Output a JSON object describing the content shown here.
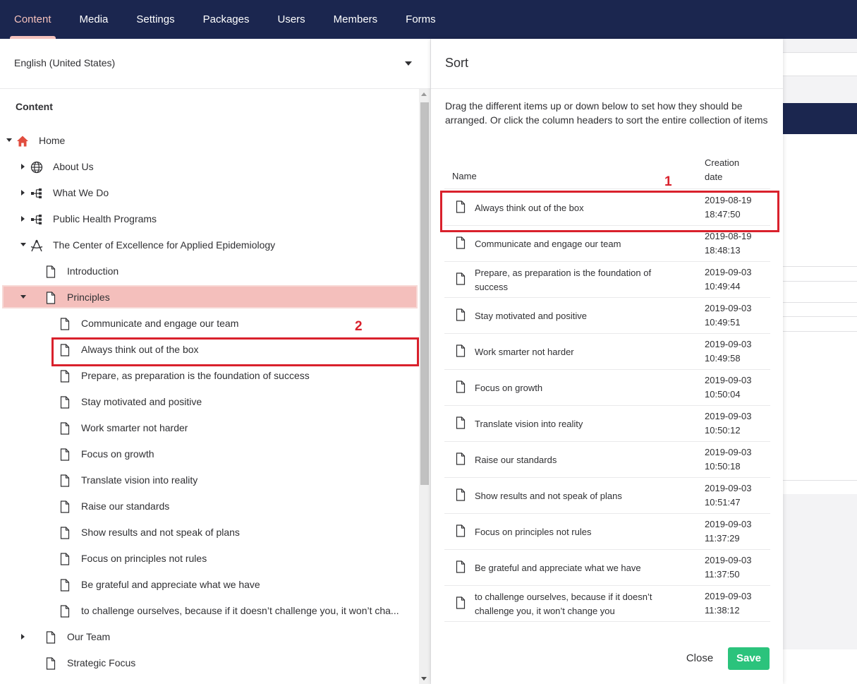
{
  "nav": {
    "items": [
      "Content",
      "Media",
      "Settings",
      "Packages",
      "Users",
      "Members",
      "Forms"
    ],
    "active": "Content"
  },
  "tree": {
    "language": "English (United States)",
    "section_title": "Content",
    "nodes": [
      {
        "label": "Home",
        "icon": "home-icon",
        "arrow": "down",
        "depth": 0
      },
      {
        "label": "About Us",
        "icon": "globe-icon",
        "arrow": "right",
        "depth": 1
      },
      {
        "label": "What We Do",
        "icon": "sitemap-icon",
        "arrow": "right",
        "depth": 1
      },
      {
        "label": "Public Health Programs",
        "icon": "sitemap-icon",
        "arrow": "right",
        "depth": 1
      },
      {
        "label": "The Center of Excellence for Applied Epidemiology",
        "icon": "compass-icon",
        "arrow": "down",
        "depth": 1
      },
      {
        "label": "Introduction",
        "icon": "document-icon",
        "arrow": "",
        "depth": 2
      },
      {
        "label": "Principles",
        "icon": "document-icon",
        "arrow": "down",
        "depth": 2,
        "selected": true
      },
      {
        "label": "Communicate and engage our team",
        "icon": "document-icon",
        "arrow": "",
        "depth": 3
      },
      {
        "label": "Always think out of the box",
        "icon": "document-icon",
        "arrow": "",
        "depth": 3
      },
      {
        "label": "Prepare, as preparation is the foundation of success",
        "icon": "document-icon",
        "arrow": "",
        "depth": 3
      },
      {
        "label": "Stay motivated and positive",
        "icon": "document-icon",
        "arrow": "",
        "depth": 3
      },
      {
        "label": "Work smarter not harder",
        "icon": "document-icon",
        "arrow": "",
        "depth": 3
      },
      {
        "label": "Focus on growth",
        "icon": "document-icon",
        "arrow": "",
        "depth": 3
      },
      {
        "label": "Translate vision into reality",
        "icon": "document-icon",
        "arrow": "",
        "depth": 3
      },
      {
        "label": "Raise our standards",
        "icon": "document-icon",
        "arrow": "",
        "depth": 3
      },
      {
        "label": "Show results and not speak of plans",
        "icon": "document-icon",
        "arrow": "",
        "depth": 3
      },
      {
        "label": "Focus on principles not rules",
        "icon": "document-icon",
        "arrow": "",
        "depth": 3
      },
      {
        "label": "Be grateful and appreciate what we have",
        "icon": "document-icon",
        "arrow": "",
        "depth": 3
      },
      {
        "label": "to challenge ourselves, because if it doesn’t challenge you, it won’t cha...",
        "icon": "document-icon",
        "arrow": "",
        "depth": 3
      },
      {
        "label": "Our Team",
        "icon": "document-icon",
        "arrow": "right",
        "depth": 2
      },
      {
        "label": "Strategic Focus",
        "icon": "document-icon",
        "arrow": "",
        "depth": 2
      }
    ]
  },
  "annotations": {
    "marker_1": "1",
    "marker_2": "2"
  },
  "sort_dialog": {
    "title": "Sort",
    "description": "Drag the different items up or down below to set how they should be arranged. Or click the column headers to sort the entire collection of items",
    "col_name": "Name",
    "col_date": "Creation date",
    "rows": [
      {
        "name": "Always think out of the box",
        "date": "2019-08-19 18:47:50"
      },
      {
        "name": "Communicate and engage our team",
        "date": "2019-08-19 18:48:13"
      },
      {
        "name": "Prepare, as preparation is the foundation of success",
        "date": "2019-09-03 10:49:44"
      },
      {
        "name": "Stay motivated and positive",
        "date": "2019-09-03 10:49:51"
      },
      {
        "name": "Work smarter not harder",
        "date": "2019-09-03 10:49:58"
      },
      {
        "name": "Focus on growth",
        "date": "2019-09-03 10:50:04"
      },
      {
        "name": "Translate vision into reality",
        "date": "2019-09-03 10:50:12"
      },
      {
        "name": "Raise our standards",
        "date": "2019-09-03 10:50:18"
      },
      {
        "name": "Show results and not speak of plans",
        "date": "2019-09-03 10:51:47"
      },
      {
        "name": "Focus on principles not rules",
        "date": "2019-09-03 11:37:29"
      },
      {
        "name": "Be grateful and appreciate what we have",
        "date": "2019-09-03 11:37:50"
      },
      {
        "name": "to challenge ourselves, because if it doesn’t challenge you, it won’t change you",
        "date": "2019-09-03 11:38:12"
      }
    ],
    "close_label": "Close",
    "save_label": "Save"
  },
  "colors": {
    "nav_bg": "#1b264f",
    "nav_active": "#f5c1bc",
    "selected_bg": "#f4bfbc",
    "annotation_red": "#d9212c",
    "save_green": "#2bc37c",
    "home_icon": "#e14d3f"
  }
}
